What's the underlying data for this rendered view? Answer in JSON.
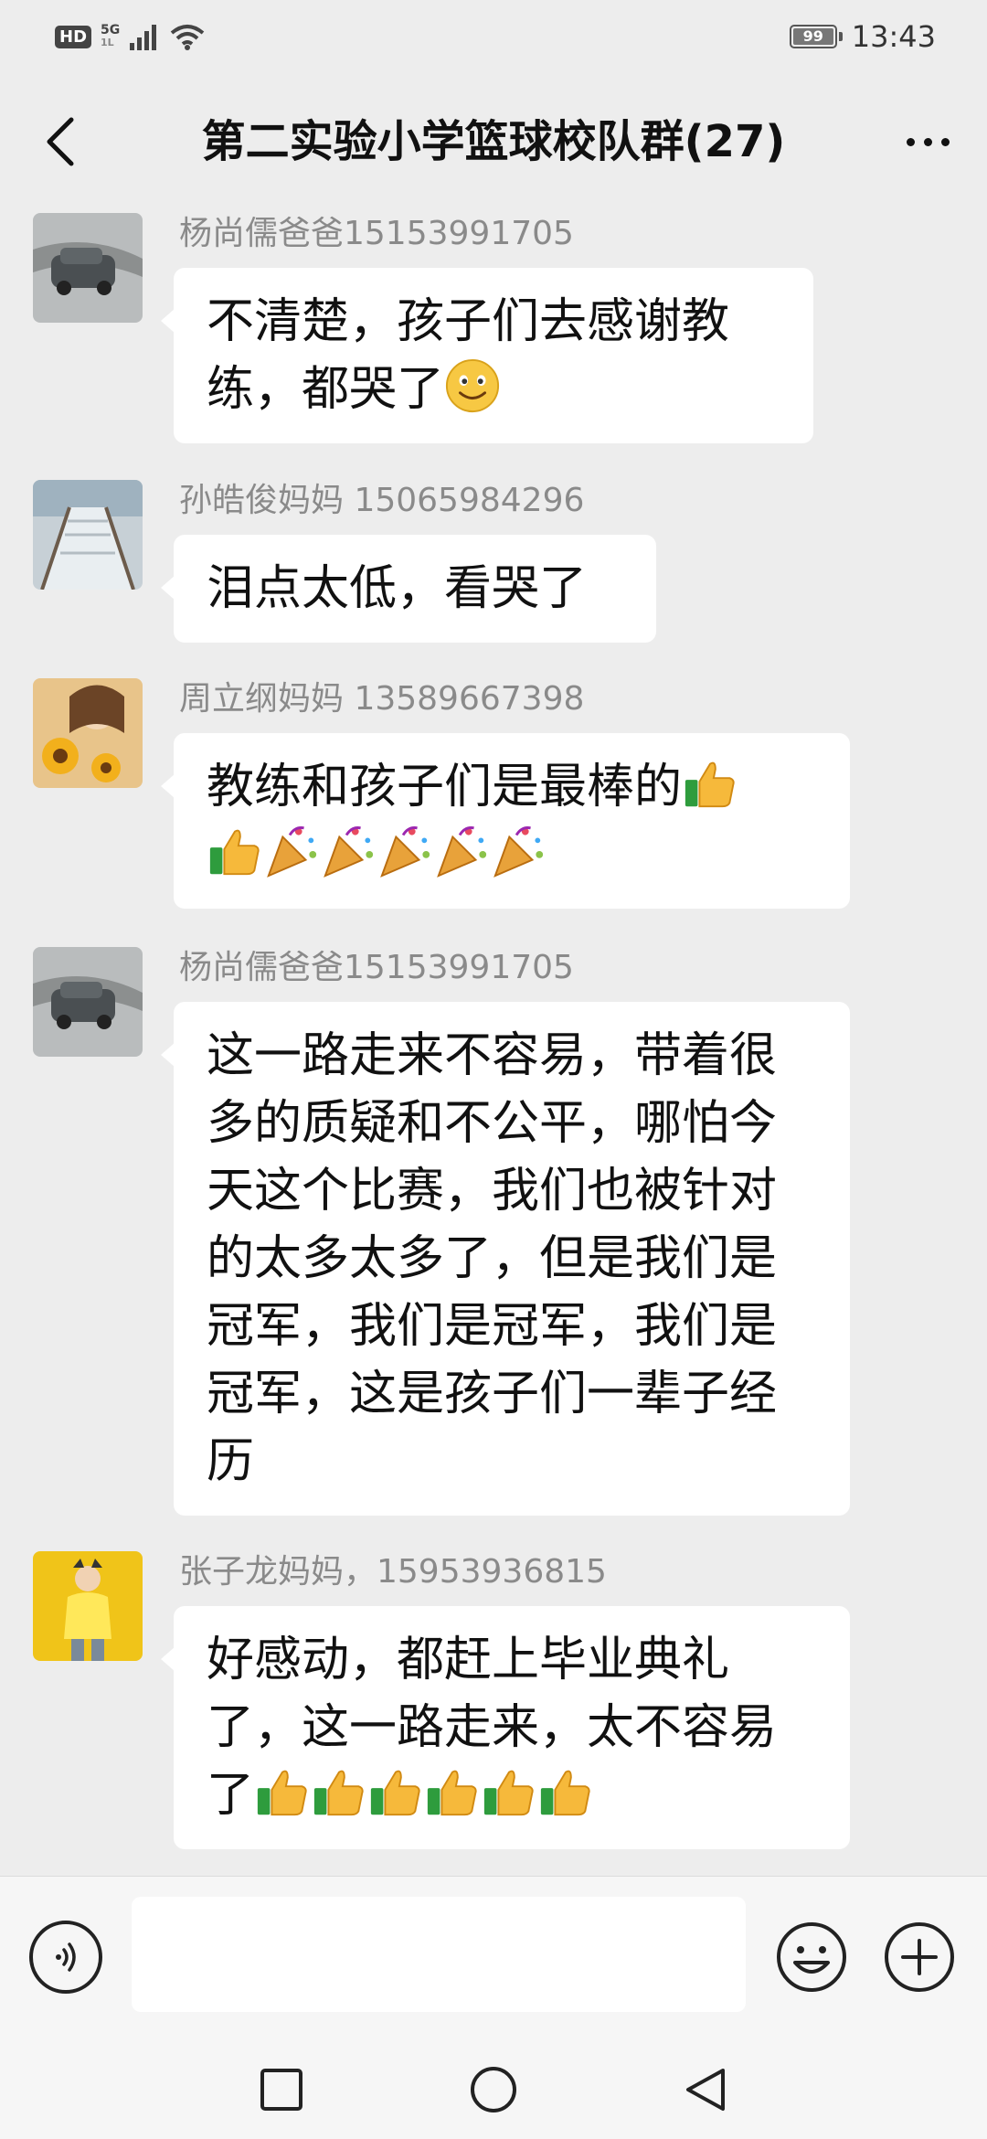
{
  "status_bar": {
    "hd": "HD",
    "network": "5G",
    "network_sub": "1L",
    "battery": "99",
    "time": "13:43"
  },
  "header": {
    "title": "第二实验小学篮球校队群(27)",
    "back_icon": "chevron-left-icon",
    "more_icon": "more-dots-icon"
  },
  "messages": [
    {
      "sender": "杨尚儒爸爸15153991705",
      "avatar": "car-photo",
      "lines": [
        "不清楚，孩子们去感谢教",
        "练，都哭了"
      ],
      "trailing_emoji": "smile-emoji"
    },
    {
      "sender": "孙皓俊妈妈  15065984296",
      "avatar": "snow-stairs-photo",
      "lines": [
        "泪点太低，看哭了"
      ]
    },
    {
      "sender": "周立纲妈妈 13589667398",
      "avatar": "sunflower-girl-photo",
      "lines": [
        "教练和孩子们是最棒的"
      ],
      "emoji_line": [
        "thumbs-up",
        "party-popper",
        "party-popper",
        "party-popper",
        "party-popper",
        "party-popper"
      ]
    },
    {
      "sender": "杨尚儒爸爸15153991705",
      "avatar": "car-photo",
      "lines": [
        "这一路走来不容易，带着很",
        "多的质疑和不公平，哪怕今",
        "天这个比赛，我们也被针对",
        "的太多太多了，但是我们是",
        "冠军，我们是冠军，我们是",
        "冠军，这是孩子们一辈子经",
        "历"
      ]
    },
    {
      "sender": "张子龙妈妈，15953936815",
      "avatar": "yellow-kid-photo",
      "lines": [
        "好感动，都赶上毕业典礼",
        "了，这一路走来，太不容易",
        "了"
      ],
      "trailing_emoji_count": 6
    }
  ],
  "input": {
    "placeholder": "",
    "voice_icon": "voice-icon",
    "emoji_icon": "emoji-icon",
    "plus_icon": "plus-icon"
  },
  "navbar": {
    "recent_icon": "square-icon",
    "home_icon": "circle-icon",
    "back_icon": "triangle-back-icon"
  }
}
